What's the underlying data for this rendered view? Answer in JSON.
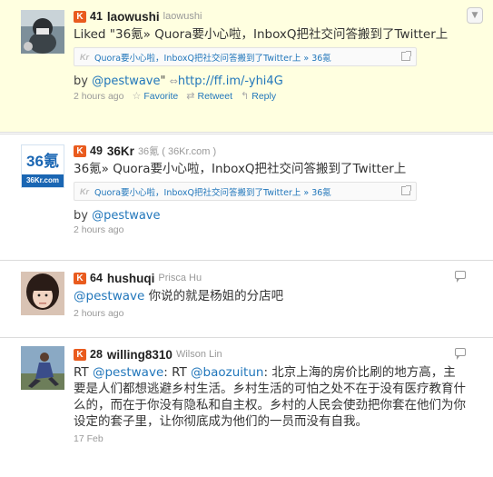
{
  "tweets": [
    {
      "score": "41",
      "username": "laowushi",
      "realname": "laowushi",
      "text": "Liked \"36氪» Quora要小心啦，InboxQ把社交问答搬到了Twitter上",
      "card_text": "Quora要小心啦，InboxQ把社交问答搬到了Twitter上 » 36氪",
      "card_prefix": "Kr",
      "by_prefix": "by ",
      "by_mention": "@pestwave",
      "by_suffix": "\" ",
      "link_icon": "link-icon",
      "link": "http://ff.im/-yhi4G",
      "time": "2 hours ago",
      "favorite": "Favorite",
      "retweet": "Retweet",
      "reply": "Reply"
    },
    {
      "score": "49",
      "username": "36Kr",
      "realname": "36氪 ( 36Kr.com )",
      "avatar_big": "36氪",
      "avatar_small": "36Kr.com",
      "text": "36氪» Quora要小心啦，InboxQ把社交问答搬到了Twitter上",
      "card_text": "Quora要小心啦，InboxQ把社交问答搬到了Twitter上 » 36氪",
      "card_prefix": "Kr",
      "by_prefix": "by ",
      "by_mention": "@pestwave",
      "time": "2 hours ago"
    },
    {
      "score": "64",
      "username": "hushuqi",
      "realname": "Prisca Hu",
      "mention": "@pestwave",
      "text": " 你说的就是杨姐的分店吧",
      "time": "2 hours ago"
    },
    {
      "score": "28",
      "username": "willing8310",
      "realname": "Wilson Lin",
      "rt": "RT ",
      "mention1": "@pestwave",
      "mid": ": RT ",
      "mention2": "@baozuitun",
      "text": ": 北京上海的房价比刷的地方高，主要是人们都想逃避乡村生活。乡村生活的可怕之处不在于没有医疗教育什么的，而在于你没有隐私和自主权。乡村的人民会使劲把你套在他们为你设定的套子里，让你彻底成为他们的一员而没有自我。",
      "time": "17 Feb"
    }
  ],
  "icons": {
    "k": "K",
    "corner": "▼"
  },
  "colors": {
    "highlight": "#ffffe0",
    "link": "#2277bb",
    "badge": "#e95b1e"
  }
}
